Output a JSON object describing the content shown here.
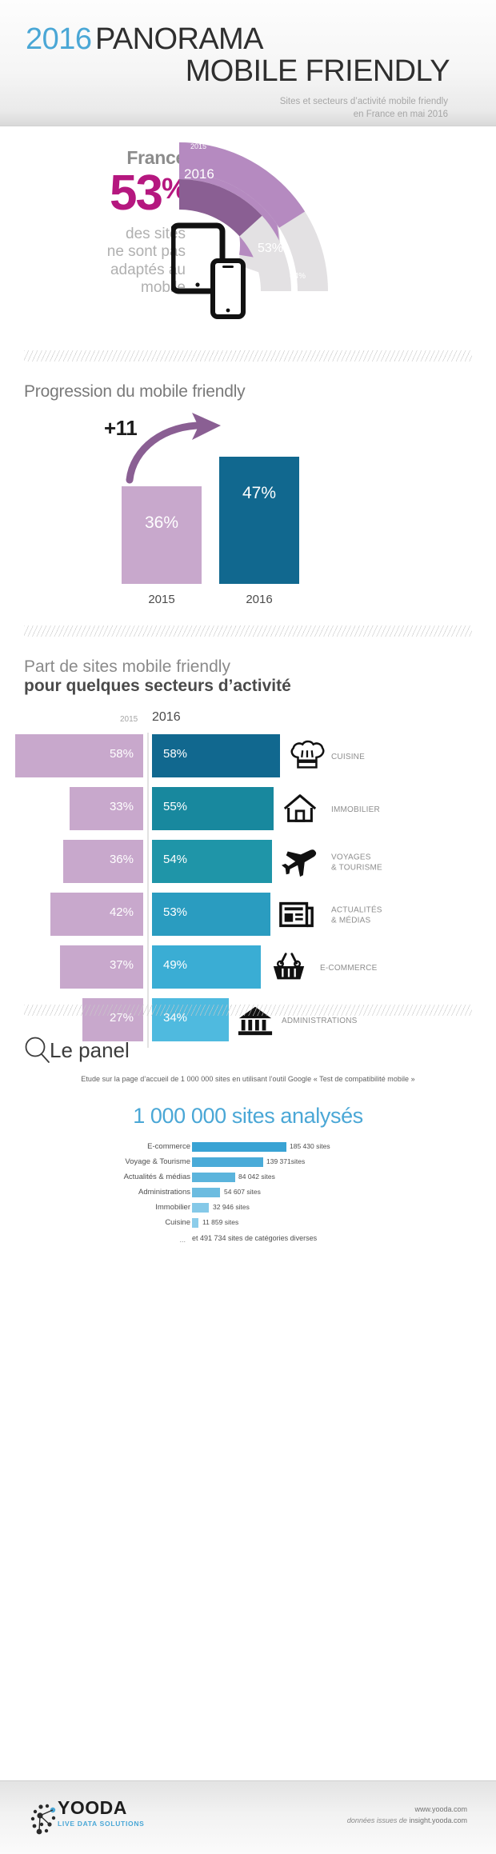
{
  "header": {
    "year": "2016",
    "title_line1": "PANORAMA",
    "title_line2": "MOBILE FRIENDLY",
    "subtitle_line1": "Sites et secteurs d’activité mobile friendly",
    "subtitle_line2": "en France en mai 2016"
  },
  "france": {
    "label": "France",
    "big_number": "53",
    "big_unit": "%",
    "description_line1": "des sites",
    "description_line2": "ne sont pas",
    "description_line3": "adaptés au",
    "description_line4": "mobile",
    "arc_label_outer": "2015",
    "arc_label_inner": "2016",
    "arc_value_inner": "53%",
    "arc_value_outer": "64%"
  },
  "progression": {
    "heading": "Progression du mobile friendly",
    "delta_label": "+11"
  },
  "sectors": {
    "heading_line1": "Part de sites mobile friendly",
    "heading_line2": "pour quelques secteurs d’activité",
    "col_2015": "2015",
    "col_2016": "2016"
  },
  "panel": {
    "title": "Le panel",
    "description": "Etude sur la page d’accueil de 1 000 000 sites en utilisant l’outil Google « Test de compatibilité mobile »",
    "big_title": "1 000 000 sites analysés",
    "extra_dots": "...",
    "extra_text": "et 491 734 sites de catégories diverses"
  },
  "footer": {
    "logo_name": "YOODA",
    "logo_tagline": "LIVE DATA SOLUTIONS",
    "site": "www.yooda.com",
    "source_prefix": "données issues de",
    "source_link": "insight.yooda.com"
  },
  "colors": {
    "accent_blue": "#4aa7d6",
    "magenta": "#b5177f",
    "purple_light": "#c8a8cc",
    "purple_mid": "#a07aa8",
    "purple_dark": "#8a5f93",
    "teal_dark": "#11688f",
    "grey_arc": "#e3e1e3"
  },
  "chart_data": [
    {
      "type": "pie",
      "title": "France — sites non adaptés au mobile",
      "series": [
        {
          "name": "2015",
          "value": 64,
          "label": "64%",
          "color": "#b58ac0"
        },
        {
          "name": "2016",
          "value": 53,
          "label": "53%",
          "color": "#8a5f93"
        }
      ],
      "ylim": [
        0,
        100
      ],
      "grid": false,
      "legend": "inline"
    },
    {
      "type": "bar",
      "title": "Progression du mobile friendly",
      "categories": [
        "2015",
        "2016"
      ],
      "values": [
        36,
        47
      ],
      "value_labels": [
        "36%",
        "47%"
      ],
      "annotation": "+11",
      "colors": [
        "#c8a8cc",
        "#11688f"
      ],
      "xlabel": "",
      "ylabel": "",
      "ylim": [
        0,
        60
      ],
      "grid": false
    },
    {
      "type": "bar",
      "title": "Part de sites mobile friendly pour quelques secteurs d’activité",
      "orientation": "horizontal",
      "categories": [
        "CUISINE",
        "IMMOBILIER",
        "VOYAGES & TOURISME",
        "ACTUALITÉS & MÉDIAS",
        "E-COMMERCE",
        "ADMINISTRATIONS"
      ],
      "series": [
        {
          "name": "2015",
          "values": [
            58,
            33,
            36,
            42,
            37,
            27
          ],
          "labels": [
            "58%",
            "33%",
            "36%",
            "42%",
            "37%",
            "27%"
          ],
          "color": "#c8a8cc"
        },
        {
          "name": "2016",
          "values": [
            58,
            55,
            54,
            53,
            49,
            34
          ],
          "labels": [
            "58%",
            "55%",
            "54%",
            "53%",
            "49%",
            "34%"
          ],
          "colors": [
            "#11688f",
            "#18889e",
            "#1f95a8",
            "#2a9cc0",
            "#3aadd4",
            "#4fbadf"
          ]
        }
      ],
      "icons": [
        "chef-hat-icon",
        "house-icon",
        "airplane-icon",
        "newspaper-icon",
        "basket-icon",
        "bank-icon"
      ],
      "ylim": [
        0,
        60
      ],
      "grid": false,
      "legend": "top"
    },
    {
      "type": "bar",
      "title": "1 000 000 sites analysés",
      "orientation": "horizontal",
      "categories": [
        "E-commerce",
        "Voyage & Tourisme",
        "Actualités & médias",
        "Administrations",
        "Immobilier",
        "Cuisine"
      ],
      "values": [
        185430,
        139371,
        84042,
        54607,
        32946,
        11859
      ],
      "value_labels": [
        "185 430 sites",
        "139 371sites",
        "84 042 sites",
        "54 607 sites",
        "32 946  sites",
        "11 859 sites"
      ],
      "colors": [
        "#39a3d4",
        "#4aabd8",
        "#5bb4dc",
        "#6cbce0",
        "#85c9e8",
        "#8ccdea"
      ],
      "xlabel": "",
      "ylabel": "",
      "grid": false,
      "note": "et 491 734 sites de catégories diverses"
    }
  ]
}
